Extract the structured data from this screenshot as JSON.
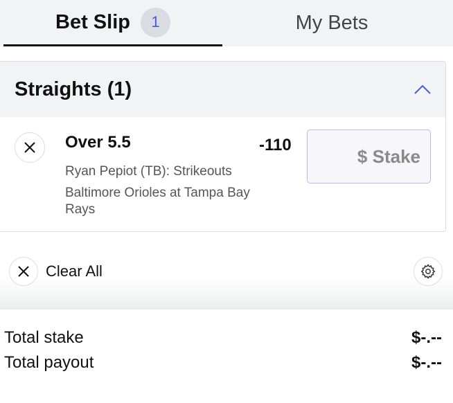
{
  "tabs": {
    "betslip_label": "Bet Slip",
    "betslip_count": "1",
    "mybets_label": "My Bets"
  },
  "section": {
    "title": "Straights (1)",
    "expanded": true
  },
  "bet": {
    "selection": "Over 5.5",
    "market": "Ryan Pepiot (TB): Strikeouts",
    "game": "Baltimore Orioles at Tampa Bay Rays",
    "odds": "-110",
    "stake_placeholder": "$ Stake",
    "stake_value": ""
  },
  "actions": {
    "clear_all_label": "Clear All"
  },
  "totals": {
    "stake_label": "Total stake",
    "stake_value": "$-.--",
    "payout_label": "Total payout",
    "payout_value": "$-.--"
  },
  "icons": {
    "remove": "close-icon",
    "clear": "close-icon",
    "collapse": "chevron-up-icon",
    "settings": "gear-icon"
  },
  "colors": {
    "accent": "#4a5bd6",
    "tab_background": "#f2f3f5",
    "stake_border": "#b8bde6"
  }
}
